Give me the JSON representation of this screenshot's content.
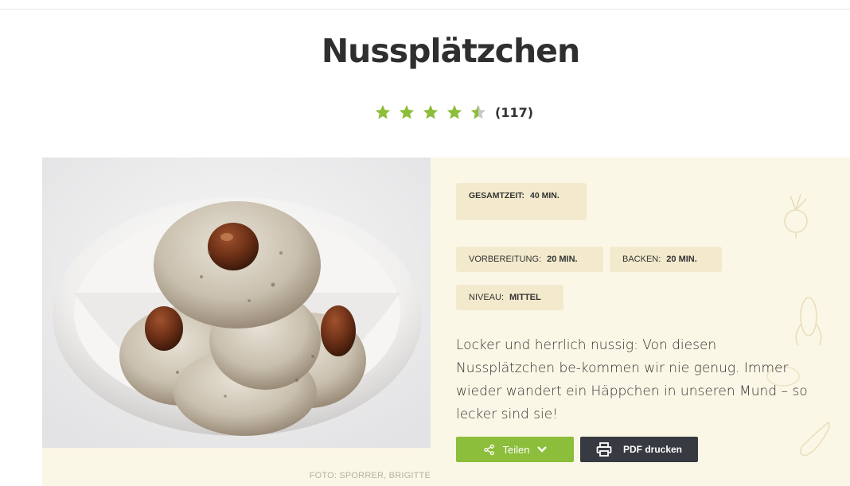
{
  "recipe": {
    "title": "Nussplätzchen",
    "rating": 4.5,
    "rating_count": "(117)",
    "photo_credit": "FOTO: SPORRER, BRIGITTE",
    "total_time": {
      "label": "GESAMTZEIT:",
      "value": "40 MIN."
    },
    "prep_time": {
      "label": "VORBEREITUNG:",
      "value": "20 MIN."
    },
    "bake_time": {
      "label": "BACKEN:",
      "value": "20 MIN."
    },
    "level": {
      "label": "NIVEAU:",
      "value": "MITTEL"
    },
    "description": "Locker und herrlich nussig: Von diesen Nussplätzchen be-kommen wir nie genug. Immer wieder wandert ein Häppchen in unseren Mund – so lecker sind sie!"
  },
  "actions": {
    "share_label": "Teilen",
    "print_label": "PDF drucken"
  },
  "colors": {
    "accent_green": "#8cbd3b",
    "dark_button": "#373a41",
    "panel_bg": "#fbf7e6",
    "chip_bg": "#f3eace"
  },
  "icons": {
    "share": "share-icon",
    "chevron": "chevron-down-icon",
    "print": "printer-icon",
    "star": "star-icon"
  }
}
